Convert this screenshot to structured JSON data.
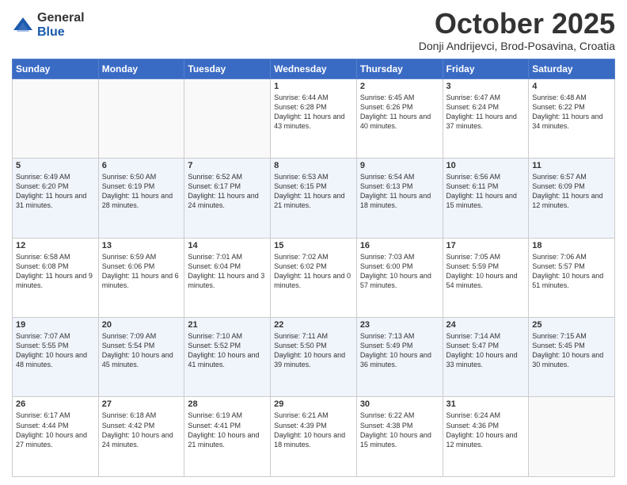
{
  "logo": {
    "general": "General",
    "blue": "Blue"
  },
  "header": {
    "month": "October 2025",
    "location": "Donji Andrijevci, Brod-Posavina, Croatia"
  },
  "days_of_week": [
    "Sunday",
    "Monday",
    "Tuesday",
    "Wednesday",
    "Thursday",
    "Friday",
    "Saturday"
  ],
  "weeks": [
    [
      {
        "day": "",
        "info": ""
      },
      {
        "day": "",
        "info": ""
      },
      {
        "day": "",
        "info": ""
      },
      {
        "day": "1",
        "info": "Sunrise: 6:44 AM\nSunset: 6:28 PM\nDaylight: 11 hours and 43 minutes."
      },
      {
        "day": "2",
        "info": "Sunrise: 6:45 AM\nSunset: 6:26 PM\nDaylight: 11 hours and 40 minutes."
      },
      {
        "day": "3",
        "info": "Sunrise: 6:47 AM\nSunset: 6:24 PM\nDaylight: 11 hours and 37 minutes."
      },
      {
        "day": "4",
        "info": "Sunrise: 6:48 AM\nSunset: 6:22 PM\nDaylight: 11 hours and 34 minutes."
      }
    ],
    [
      {
        "day": "5",
        "info": "Sunrise: 6:49 AM\nSunset: 6:20 PM\nDaylight: 11 hours and 31 minutes."
      },
      {
        "day": "6",
        "info": "Sunrise: 6:50 AM\nSunset: 6:19 PM\nDaylight: 11 hours and 28 minutes."
      },
      {
        "day": "7",
        "info": "Sunrise: 6:52 AM\nSunset: 6:17 PM\nDaylight: 11 hours and 24 minutes."
      },
      {
        "day": "8",
        "info": "Sunrise: 6:53 AM\nSunset: 6:15 PM\nDaylight: 11 hours and 21 minutes."
      },
      {
        "day": "9",
        "info": "Sunrise: 6:54 AM\nSunset: 6:13 PM\nDaylight: 11 hours and 18 minutes."
      },
      {
        "day": "10",
        "info": "Sunrise: 6:56 AM\nSunset: 6:11 PM\nDaylight: 11 hours and 15 minutes."
      },
      {
        "day": "11",
        "info": "Sunrise: 6:57 AM\nSunset: 6:09 PM\nDaylight: 11 hours and 12 minutes."
      }
    ],
    [
      {
        "day": "12",
        "info": "Sunrise: 6:58 AM\nSunset: 6:08 PM\nDaylight: 11 hours and 9 minutes."
      },
      {
        "day": "13",
        "info": "Sunrise: 6:59 AM\nSunset: 6:06 PM\nDaylight: 11 hours and 6 minutes."
      },
      {
        "day": "14",
        "info": "Sunrise: 7:01 AM\nSunset: 6:04 PM\nDaylight: 11 hours and 3 minutes."
      },
      {
        "day": "15",
        "info": "Sunrise: 7:02 AM\nSunset: 6:02 PM\nDaylight: 11 hours and 0 minutes."
      },
      {
        "day": "16",
        "info": "Sunrise: 7:03 AM\nSunset: 6:00 PM\nDaylight: 10 hours and 57 minutes."
      },
      {
        "day": "17",
        "info": "Sunrise: 7:05 AM\nSunset: 5:59 PM\nDaylight: 10 hours and 54 minutes."
      },
      {
        "day": "18",
        "info": "Sunrise: 7:06 AM\nSunset: 5:57 PM\nDaylight: 10 hours and 51 minutes."
      }
    ],
    [
      {
        "day": "19",
        "info": "Sunrise: 7:07 AM\nSunset: 5:55 PM\nDaylight: 10 hours and 48 minutes."
      },
      {
        "day": "20",
        "info": "Sunrise: 7:09 AM\nSunset: 5:54 PM\nDaylight: 10 hours and 45 minutes."
      },
      {
        "day": "21",
        "info": "Sunrise: 7:10 AM\nSunset: 5:52 PM\nDaylight: 10 hours and 41 minutes."
      },
      {
        "day": "22",
        "info": "Sunrise: 7:11 AM\nSunset: 5:50 PM\nDaylight: 10 hours and 39 minutes."
      },
      {
        "day": "23",
        "info": "Sunrise: 7:13 AM\nSunset: 5:49 PM\nDaylight: 10 hours and 36 minutes."
      },
      {
        "day": "24",
        "info": "Sunrise: 7:14 AM\nSunset: 5:47 PM\nDaylight: 10 hours and 33 minutes."
      },
      {
        "day": "25",
        "info": "Sunrise: 7:15 AM\nSunset: 5:45 PM\nDaylight: 10 hours and 30 minutes."
      }
    ],
    [
      {
        "day": "26",
        "info": "Sunrise: 6:17 AM\nSunset: 4:44 PM\nDaylight: 10 hours and 27 minutes."
      },
      {
        "day": "27",
        "info": "Sunrise: 6:18 AM\nSunset: 4:42 PM\nDaylight: 10 hours and 24 minutes."
      },
      {
        "day": "28",
        "info": "Sunrise: 6:19 AM\nSunset: 4:41 PM\nDaylight: 10 hours and 21 minutes."
      },
      {
        "day": "29",
        "info": "Sunrise: 6:21 AM\nSunset: 4:39 PM\nDaylight: 10 hours and 18 minutes."
      },
      {
        "day": "30",
        "info": "Sunrise: 6:22 AM\nSunset: 4:38 PM\nDaylight: 10 hours and 15 minutes."
      },
      {
        "day": "31",
        "info": "Sunrise: 6:24 AM\nSunset: 4:36 PM\nDaylight: 10 hours and 12 minutes."
      },
      {
        "day": "",
        "info": ""
      }
    ]
  ]
}
